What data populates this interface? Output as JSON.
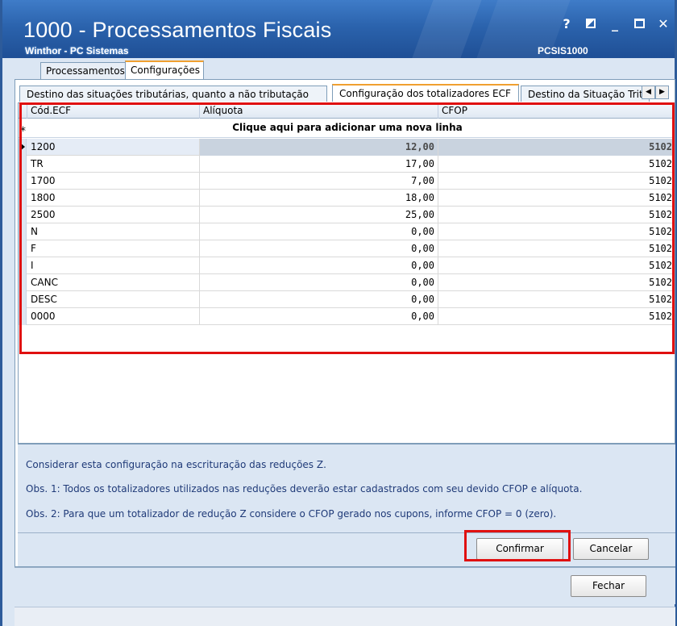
{
  "window": {
    "title": "1000 - Processamentos Fiscais",
    "subtitle": "Winthor - PC Sistemas",
    "code": "PCSIS1000",
    "buttons": {
      "help": "?",
      "minimize": "_",
      "close": "✕"
    }
  },
  "main_tabs": [
    {
      "label": "Processamentos",
      "active": false
    },
    {
      "label": "Configurações",
      "active": true
    }
  ],
  "sub_tabs": [
    {
      "label": "Destino das situações tributárias, quanto a não tributação",
      "active": false
    },
    {
      "label": "Configuração dos totalizadores ECF",
      "active": true
    },
    {
      "label": "Destino da Situação Trit",
      "active": false
    }
  ],
  "grid": {
    "columns": [
      "Cód.ECF",
      "Alíquota",
      "CFOP"
    ],
    "new_row_text": "Clique aqui para adicionar uma nova linha",
    "new_row_marker": "*",
    "rows": [
      {
        "cod": "1200",
        "aliquota": "12,00",
        "cfop": "5102"
      },
      {
        "cod": "TR",
        "aliquota": "17,00",
        "cfop": "5102"
      },
      {
        "cod": "1700",
        "aliquota": "7,00",
        "cfop": "5102"
      },
      {
        "cod": "1800",
        "aliquota": "18,00",
        "cfop": "5102"
      },
      {
        "cod": "2500",
        "aliquota": "25,00",
        "cfop": "5102"
      },
      {
        "cod": "N",
        "aliquota": "0,00",
        "cfop": "5102"
      },
      {
        "cod": "F",
        "aliquota": "0,00",
        "cfop": "5102"
      },
      {
        "cod": "I",
        "aliquota": "0,00",
        "cfop": "5102"
      },
      {
        "cod": "CANC",
        "aliquota": "0,00",
        "cfop": "5102"
      },
      {
        "cod": "DESC",
        "aliquota": "0,00",
        "cfop": "5102"
      },
      {
        "cod": "0000",
        "aliquota": "0,00",
        "cfop": "5102"
      }
    ]
  },
  "notes": [
    "Considerar esta configuração na escrituração das reduções Z.",
    "Obs. 1: Todos os totalizadores utilizados nas reduções deverão estar cadastrados com seu devido CFOP e alíquota.",
    "Obs. 2: Para que um totalizador de redução Z considere o CFOP gerado nos cupons, informe CFOP = 0 (zero)."
  ],
  "actions": {
    "confirm": "Confirmar",
    "cancel": "Cancelar",
    "close": "Fechar"
  },
  "colors": {
    "title_bar": "#2b63ad",
    "highlight": "#e01010",
    "active_tab_accent": "#f0a030"
  }
}
